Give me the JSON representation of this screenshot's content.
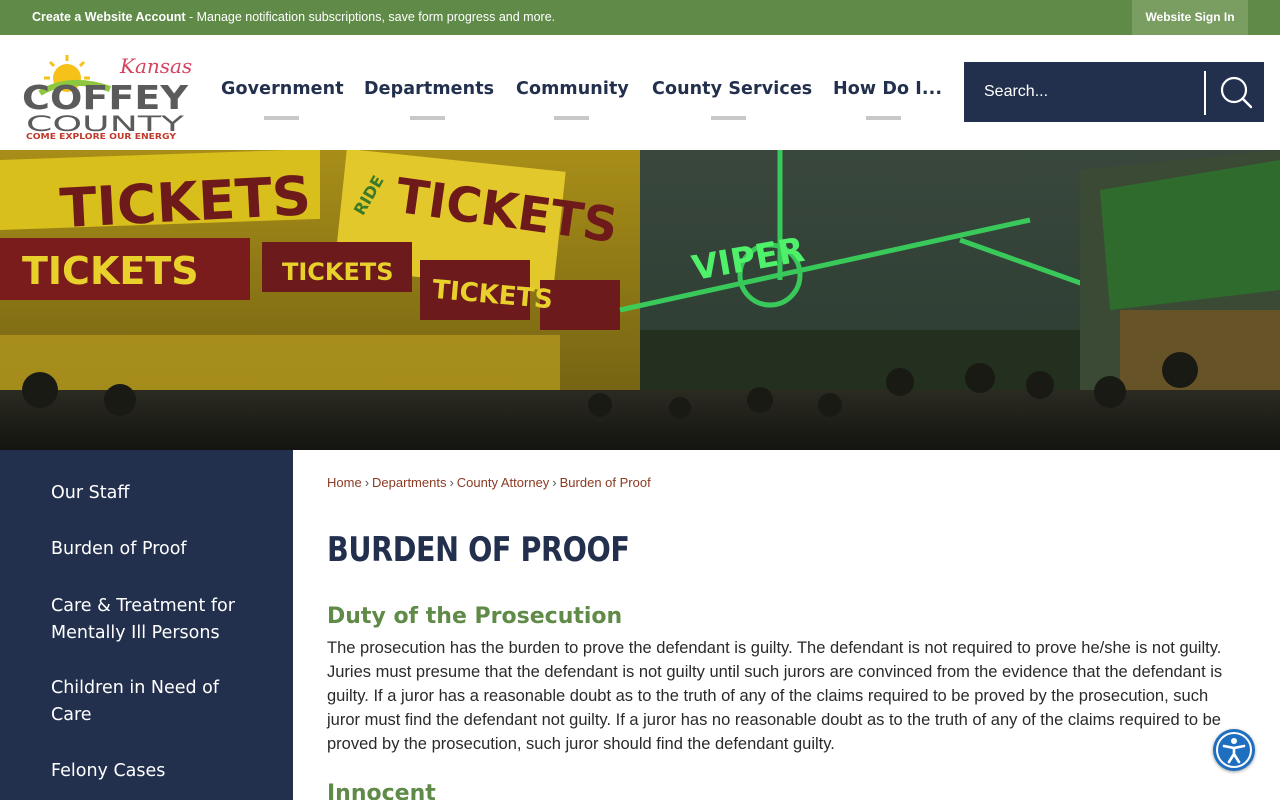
{
  "topbar": {
    "create_account_label": "Create a Website Account",
    "message": " - Manage notification subscriptions, save form progress and more.",
    "sign_in_label": "Website Sign In",
    "background_color": "#5f8a47"
  },
  "logo": {
    "state": "Kansas",
    "name_line1": "COFFEY",
    "name_line2": "COUNTY",
    "tagline": "COME EXPLORE OUR ENERGY"
  },
  "nav": {
    "items": [
      {
        "label": "Government"
      },
      {
        "label": "Departments"
      },
      {
        "label": "Community"
      },
      {
        "label": "County Services"
      },
      {
        "label": "How Do I..."
      }
    ]
  },
  "search": {
    "placeholder": "Search...",
    "icon": "search-icon"
  },
  "banner": {
    "sign_words": [
      "TICKETS",
      "TICKETS",
      "TICKETS",
      "TICKETS",
      "TICKETS",
      "RIDE",
      "VIPER"
    ]
  },
  "sidebar": {
    "items": [
      {
        "label": "Our Staff"
      },
      {
        "label": "Burden of Proof"
      },
      {
        "label": "Care & Treatment for Mentally Ill Persons"
      },
      {
        "label": "Children in Need of Care"
      },
      {
        "label": "Felony Cases"
      }
    ]
  },
  "breadcrumb": {
    "items": [
      "Home",
      "Departments",
      "County Attorney",
      "Burden of Proof"
    ],
    "separator": "›"
  },
  "page": {
    "title": "BURDEN OF PROOF",
    "sections": [
      {
        "heading": "Duty of the Prosecution",
        "body": "The prosecution has the burden to prove the defendant is guilty. The defendant is not required to prove he/she is not guilty. Juries must presume that the defendant is not guilty until such jurors are convinced from the evidence that the defendant is guilty. If a juror has a reasonable doubt as to the truth of any of the claims required to be proved by the prosecution, such juror must find the defendant not guilty. If a juror has no reasonable doubt as to the truth of any of the claims required to be proved by the prosecution, such juror should find the defendant guilty."
      },
      {
        "heading": "Innocent"
      }
    ]
  },
  "accessibility": {
    "icon": "accessibility-icon",
    "color": "#1f6fc0"
  },
  "colors": {
    "navy": "#23304d",
    "green": "#5f8a47",
    "link": "#8a3a22"
  }
}
